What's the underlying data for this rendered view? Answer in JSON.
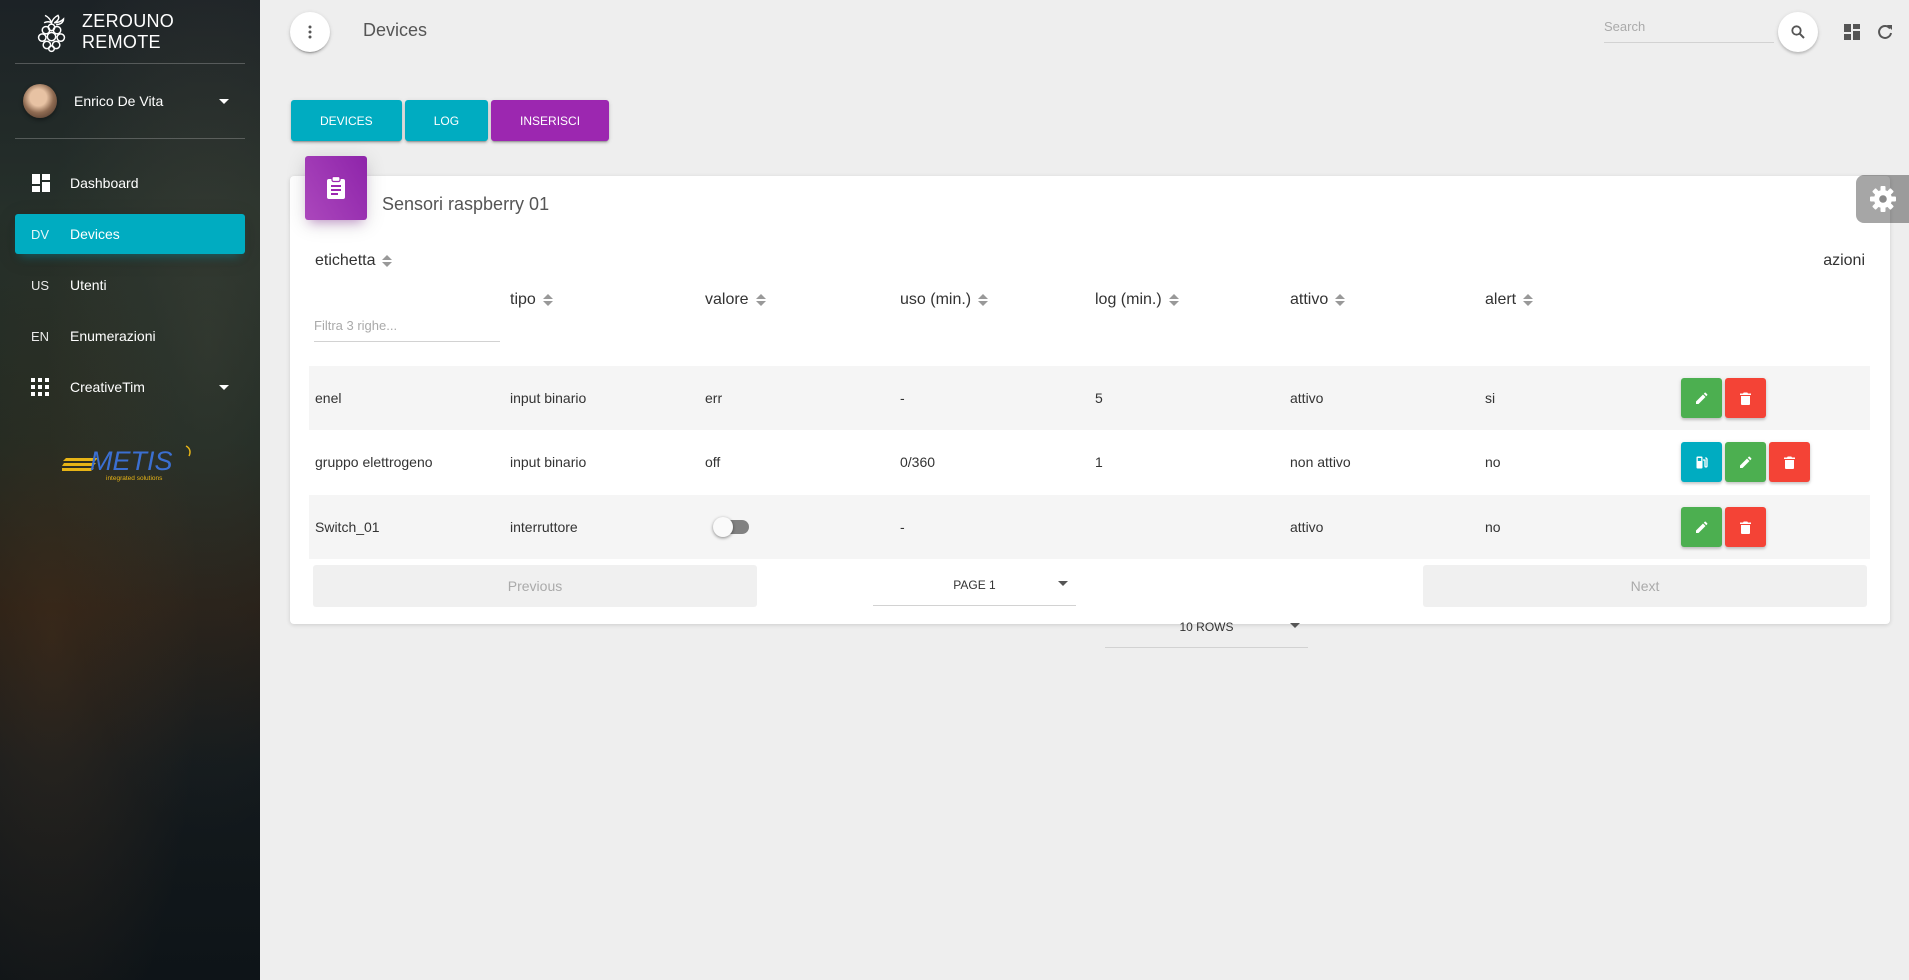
{
  "brand": {
    "name": "ZEROUNO REMOTE"
  },
  "user": {
    "name": "Enrico De Vita"
  },
  "nav": [
    {
      "mini": "",
      "label": "Dashboard",
      "icon": "dashboard-icon"
    },
    {
      "mini": "DV",
      "label": "Devices",
      "active": true
    },
    {
      "mini": "US",
      "label": "Utenti"
    },
    {
      "mini": "EN",
      "label": "Enumerazioni"
    },
    {
      "mini": "",
      "label": "CreativeTim",
      "icon": "apps-icon"
    }
  ],
  "partner_logo": {
    "text": "METIS",
    "tagline": "integrated solutions"
  },
  "header": {
    "title": "Devices",
    "search_placeholder": "Search"
  },
  "tabs": [
    "DEVICES",
    "LOG",
    "INSERISCI"
  ],
  "card": {
    "title": "Sensori raspberry 01",
    "filter_placeholder": "Filtra 3 righe..."
  },
  "table": {
    "headers": {
      "etichetta": "etichetta",
      "tipo": "tipo",
      "valore": "valore",
      "uso": "uso (min.)",
      "log": "log (min.)",
      "attivo": "attivo",
      "alert": "alert",
      "azioni": "azioni"
    },
    "rows": [
      {
        "etichetta": "enel",
        "tipo": "input binario",
        "valore": "err",
        "uso": "-",
        "log": "5",
        "attivo": "attivo",
        "alert": "si"
      },
      {
        "etichetta": "gruppo elettrogeno",
        "tipo": "input binario",
        "valore": "off",
        "uso": "0/360",
        "log": "1",
        "attivo": "non attivo",
        "alert": "no"
      },
      {
        "etichetta": "Switch_01",
        "tipo": "interruttore",
        "valore": "",
        "valore_toggle_on": false,
        "uso": "-",
        "log": "",
        "attivo": "attivo",
        "alert": "no"
      }
    ]
  },
  "pagination": {
    "previous": "Previous",
    "page": "PAGE 1",
    "rows": "10 ROWS",
    "next": "Next"
  },
  "colors": {
    "accent_cyan": "#00acc1",
    "accent_purple": "#9c27b0",
    "success": "#4caf50",
    "danger": "#f44336"
  }
}
